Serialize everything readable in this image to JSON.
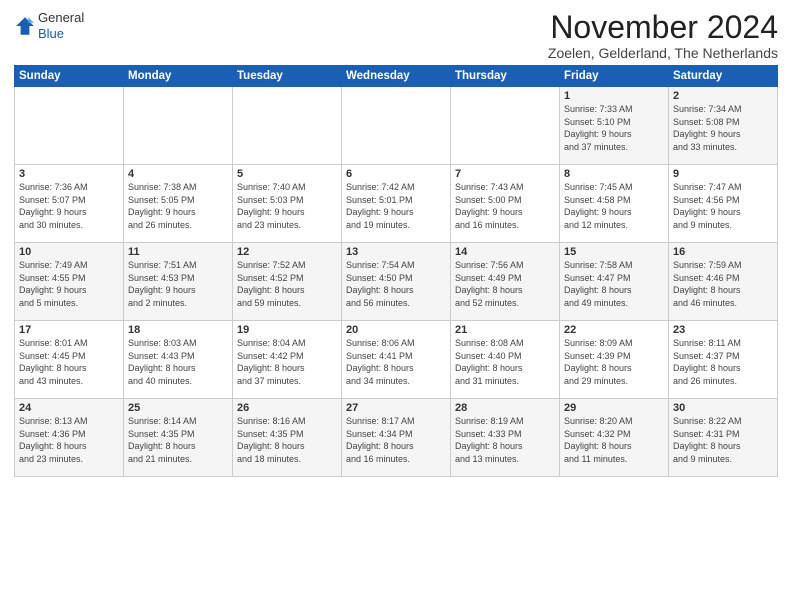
{
  "header": {
    "logo_general": "General",
    "logo_blue": "Blue",
    "month_title": "November 2024",
    "subtitle": "Zoelen, Gelderland, The Netherlands"
  },
  "weekdays": [
    "Sunday",
    "Monday",
    "Tuesday",
    "Wednesday",
    "Thursday",
    "Friday",
    "Saturday"
  ],
  "weeks": [
    [
      {
        "day": "",
        "info": ""
      },
      {
        "day": "",
        "info": ""
      },
      {
        "day": "",
        "info": ""
      },
      {
        "day": "",
        "info": ""
      },
      {
        "day": "",
        "info": ""
      },
      {
        "day": "1",
        "info": "Sunrise: 7:33 AM\nSunset: 5:10 PM\nDaylight: 9 hours\nand 37 minutes."
      },
      {
        "day": "2",
        "info": "Sunrise: 7:34 AM\nSunset: 5:08 PM\nDaylight: 9 hours\nand 33 minutes."
      }
    ],
    [
      {
        "day": "3",
        "info": "Sunrise: 7:36 AM\nSunset: 5:07 PM\nDaylight: 9 hours\nand 30 minutes."
      },
      {
        "day": "4",
        "info": "Sunrise: 7:38 AM\nSunset: 5:05 PM\nDaylight: 9 hours\nand 26 minutes."
      },
      {
        "day": "5",
        "info": "Sunrise: 7:40 AM\nSunset: 5:03 PM\nDaylight: 9 hours\nand 23 minutes."
      },
      {
        "day": "6",
        "info": "Sunrise: 7:42 AM\nSunset: 5:01 PM\nDaylight: 9 hours\nand 19 minutes."
      },
      {
        "day": "7",
        "info": "Sunrise: 7:43 AM\nSunset: 5:00 PM\nDaylight: 9 hours\nand 16 minutes."
      },
      {
        "day": "8",
        "info": "Sunrise: 7:45 AM\nSunset: 4:58 PM\nDaylight: 9 hours\nand 12 minutes."
      },
      {
        "day": "9",
        "info": "Sunrise: 7:47 AM\nSunset: 4:56 PM\nDaylight: 9 hours\nand 9 minutes."
      }
    ],
    [
      {
        "day": "10",
        "info": "Sunrise: 7:49 AM\nSunset: 4:55 PM\nDaylight: 9 hours\nand 5 minutes."
      },
      {
        "day": "11",
        "info": "Sunrise: 7:51 AM\nSunset: 4:53 PM\nDaylight: 9 hours\nand 2 minutes."
      },
      {
        "day": "12",
        "info": "Sunrise: 7:52 AM\nSunset: 4:52 PM\nDaylight: 8 hours\nand 59 minutes."
      },
      {
        "day": "13",
        "info": "Sunrise: 7:54 AM\nSunset: 4:50 PM\nDaylight: 8 hours\nand 56 minutes."
      },
      {
        "day": "14",
        "info": "Sunrise: 7:56 AM\nSunset: 4:49 PM\nDaylight: 8 hours\nand 52 minutes."
      },
      {
        "day": "15",
        "info": "Sunrise: 7:58 AM\nSunset: 4:47 PM\nDaylight: 8 hours\nand 49 minutes."
      },
      {
        "day": "16",
        "info": "Sunrise: 7:59 AM\nSunset: 4:46 PM\nDaylight: 8 hours\nand 46 minutes."
      }
    ],
    [
      {
        "day": "17",
        "info": "Sunrise: 8:01 AM\nSunset: 4:45 PM\nDaylight: 8 hours\nand 43 minutes."
      },
      {
        "day": "18",
        "info": "Sunrise: 8:03 AM\nSunset: 4:43 PM\nDaylight: 8 hours\nand 40 minutes."
      },
      {
        "day": "19",
        "info": "Sunrise: 8:04 AM\nSunset: 4:42 PM\nDaylight: 8 hours\nand 37 minutes."
      },
      {
        "day": "20",
        "info": "Sunrise: 8:06 AM\nSunset: 4:41 PM\nDaylight: 8 hours\nand 34 minutes."
      },
      {
        "day": "21",
        "info": "Sunrise: 8:08 AM\nSunset: 4:40 PM\nDaylight: 8 hours\nand 31 minutes."
      },
      {
        "day": "22",
        "info": "Sunrise: 8:09 AM\nSunset: 4:39 PM\nDaylight: 8 hours\nand 29 minutes."
      },
      {
        "day": "23",
        "info": "Sunrise: 8:11 AM\nSunset: 4:37 PM\nDaylight: 8 hours\nand 26 minutes."
      }
    ],
    [
      {
        "day": "24",
        "info": "Sunrise: 8:13 AM\nSunset: 4:36 PM\nDaylight: 8 hours\nand 23 minutes."
      },
      {
        "day": "25",
        "info": "Sunrise: 8:14 AM\nSunset: 4:35 PM\nDaylight: 8 hours\nand 21 minutes."
      },
      {
        "day": "26",
        "info": "Sunrise: 8:16 AM\nSunset: 4:35 PM\nDaylight: 8 hours\nand 18 minutes."
      },
      {
        "day": "27",
        "info": "Sunrise: 8:17 AM\nSunset: 4:34 PM\nDaylight: 8 hours\nand 16 minutes."
      },
      {
        "day": "28",
        "info": "Sunrise: 8:19 AM\nSunset: 4:33 PM\nDaylight: 8 hours\nand 13 minutes."
      },
      {
        "day": "29",
        "info": "Sunrise: 8:20 AM\nSunset: 4:32 PM\nDaylight: 8 hours\nand 11 minutes."
      },
      {
        "day": "30",
        "info": "Sunrise: 8:22 AM\nSunset: 4:31 PM\nDaylight: 8 hours\nand 9 minutes."
      }
    ]
  ]
}
